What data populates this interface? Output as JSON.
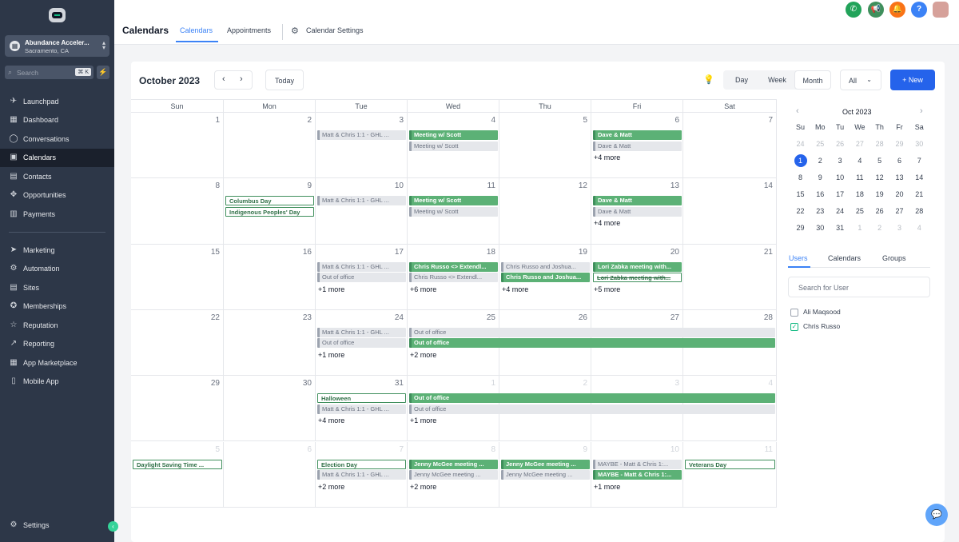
{
  "sidebar": {
    "account": {
      "name": "Abundance Acceler...",
      "location": "Sacramento, CA"
    },
    "search": {
      "placeholder": "Search",
      "shortcut": "⌘ K"
    },
    "items": [
      {
        "label": "Launchpad",
        "icon": "rocket-icon"
      },
      {
        "label": "Dashboard",
        "icon": "dashboard-icon"
      },
      {
        "label": "Conversations",
        "icon": "chat-icon"
      },
      {
        "label": "Calendars",
        "icon": "calendar-icon",
        "active": true
      },
      {
        "label": "Contacts",
        "icon": "contacts-icon"
      },
      {
        "label": "Opportunities",
        "icon": "opportunities-icon"
      },
      {
        "label": "Payments",
        "icon": "payments-icon"
      },
      {
        "label": "Marketing",
        "icon": "send-icon"
      },
      {
        "label": "Automation",
        "icon": "automation-icon"
      },
      {
        "label": "Sites",
        "icon": "sites-icon"
      },
      {
        "label": "Memberships",
        "icon": "memberships-icon"
      },
      {
        "label": "Reputation",
        "icon": "star-icon"
      },
      {
        "label": "Reporting",
        "icon": "reporting-icon"
      },
      {
        "label": "App Marketplace",
        "icon": "grid-icon"
      },
      {
        "label": "Mobile App",
        "icon": "mobile-icon"
      }
    ],
    "settings_label": "Settings"
  },
  "header": {
    "title": "Calendars",
    "tabs": [
      "Calendars",
      "Appointments"
    ],
    "settings_label": "Calendar Settings"
  },
  "toolbar": {
    "month_label": "October 2023",
    "today_label": "Today",
    "views": [
      "Day",
      "Week",
      "Month"
    ],
    "active_view": "Month",
    "filter_value": "All",
    "new_label": "+ New"
  },
  "calendar": {
    "weekdays": [
      "Sun",
      "Mon",
      "Tue",
      "Wed",
      "Thu",
      "Fri",
      "Sat"
    ],
    "weeks": [
      [
        {
          "d": "1"
        },
        {
          "d": "2"
        },
        {
          "d": "3"
        },
        {
          "d": "4"
        },
        {
          "d": "5"
        },
        {
          "d": "6"
        },
        {
          "d": "7"
        }
      ],
      [
        {
          "d": "8"
        },
        {
          "d": "9"
        },
        {
          "d": "10"
        },
        {
          "d": "11"
        },
        {
          "d": "12"
        },
        {
          "d": "13"
        },
        {
          "d": "14"
        }
      ],
      [
        {
          "d": "15"
        },
        {
          "d": "16"
        },
        {
          "d": "17"
        },
        {
          "d": "18"
        },
        {
          "d": "19"
        },
        {
          "d": "20"
        },
        {
          "d": "21"
        }
      ],
      [
        {
          "d": "22"
        },
        {
          "d": "23"
        },
        {
          "d": "24"
        },
        {
          "d": "25"
        },
        {
          "d": "26"
        },
        {
          "d": "27"
        },
        {
          "d": "28"
        }
      ],
      [
        {
          "d": "29"
        },
        {
          "d": "30"
        },
        {
          "d": "31"
        },
        {
          "d": "1",
          "other": true
        },
        {
          "d": "2",
          "other": true
        },
        {
          "d": "3",
          "other": true
        },
        {
          "d": "4",
          "other": true
        }
      ],
      [
        {
          "d": "5",
          "other": true
        },
        {
          "d": "6",
          "other": true
        },
        {
          "d": "7",
          "other": true
        },
        {
          "d": "8",
          "other": true
        },
        {
          "d": "9",
          "other": true
        },
        {
          "d": "10",
          "other": true
        },
        {
          "d": "11",
          "other": true
        }
      ]
    ],
    "events": [
      {
        "w": 0,
        "c": 2,
        "slot": 0,
        "span": 1,
        "text": "Matt & Chris 1:1 - GHL ...",
        "style": "gr"
      },
      {
        "w": 0,
        "c": 3,
        "slot": 0,
        "span": 1,
        "text": "Meeting w/ Scott",
        "style": "g"
      },
      {
        "w": 0,
        "c": 3,
        "slot": 1,
        "span": 1,
        "text": "Meeting w/ Scott",
        "style": "gr"
      },
      {
        "w": 0,
        "c": 5,
        "slot": 0,
        "span": 1,
        "text": "Dave & Matt",
        "style": "g"
      },
      {
        "w": 0,
        "c": 5,
        "slot": 1,
        "span": 1,
        "text": "Dave & Matt",
        "style": "gr"
      },
      {
        "w": 1,
        "c": 1,
        "slot": 0,
        "span": 1,
        "text": "Columbus Day",
        "style": "o"
      },
      {
        "w": 1,
        "c": 1,
        "slot": 1,
        "span": 1,
        "text": "Indigenous Peoples' Day",
        "style": "o"
      },
      {
        "w": 1,
        "c": 2,
        "slot": 0,
        "span": 1,
        "text": "Matt & Chris 1:1 - GHL ...",
        "style": "gr"
      },
      {
        "w": 1,
        "c": 3,
        "slot": 0,
        "span": 1,
        "text": "Meeting w/ Scott",
        "style": "g"
      },
      {
        "w": 1,
        "c": 3,
        "slot": 1,
        "span": 1,
        "text": "Meeting w/ Scott",
        "style": "gr"
      },
      {
        "w": 1,
        "c": 5,
        "slot": 0,
        "span": 1,
        "text": "Dave & Matt",
        "style": "g"
      },
      {
        "w": 1,
        "c": 5,
        "slot": 1,
        "span": 1,
        "text": "Dave & Matt",
        "style": "gr"
      },
      {
        "w": 2,
        "c": 2,
        "slot": 0,
        "span": 1,
        "text": "Matt & Chris 1:1 - GHL ...",
        "style": "gr"
      },
      {
        "w": 2,
        "c": 2,
        "slot": 1,
        "span": 1,
        "text": "Out of office",
        "style": "gr"
      },
      {
        "w": 2,
        "c": 3,
        "slot": 0,
        "span": 1,
        "text": "Chris Russo <> Extendl...",
        "style": "g"
      },
      {
        "w": 2,
        "c": 3,
        "slot": 1,
        "span": 1,
        "text": "Chris Russo <> Extendl...",
        "style": "gr"
      },
      {
        "w": 2,
        "c": 4,
        "slot": 0,
        "span": 1,
        "text": "Chris Russo and Joshua...",
        "style": "gr"
      },
      {
        "w": 2,
        "c": 4,
        "slot": 1,
        "span": 1,
        "text": "Chris Russo and Joshua...",
        "style": "g"
      },
      {
        "w": 2,
        "c": 5,
        "slot": 0,
        "span": 1,
        "text": "Lori Zabka meeting with...",
        "style": "g"
      },
      {
        "w": 2,
        "c": 5,
        "slot": 1,
        "span": 1,
        "text": "Lori Zabka meeting with...",
        "style": "o st"
      },
      {
        "w": 3,
        "c": 2,
        "slot": 0,
        "span": 1,
        "text": "Matt & Chris 1:1 - GHL ...",
        "style": "gr"
      },
      {
        "w": 3,
        "c": 2,
        "slot": 1,
        "span": 1,
        "text": "Out of office",
        "style": "gr"
      },
      {
        "w": 3,
        "c": 3,
        "slot": 0,
        "span": 4,
        "text": "Out of office",
        "style": "gr"
      },
      {
        "w": 3,
        "c": 3,
        "slot": 1,
        "span": 4,
        "text": "Out of office",
        "style": "g"
      },
      {
        "w": 4,
        "c": 2,
        "slot": 0,
        "span": 1,
        "text": "Halloween",
        "style": "o"
      },
      {
        "w": 4,
        "c": 2,
        "slot": 1,
        "span": 1,
        "text": "Matt & Chris 1:1 - GHL ...",
        "style": "gr"
      },
      {
        "w": 4,
        "c": 3,
        "slot": 0,
        "span": 4,
        "text": "Out of office",
        "style": "g"
      },
      {
        "w": 4,
        "c": 3,
        "slot": 1,
        "span": 4,
        "text": "Out of office",
        "style": "gr"
      },
      {
        "w": 5,
        "c": 0,
        "slot": 0,
        "span": 1,
        "text": "Daylight Saving Time ...",
        "style": "o"
      },
      {
        "w": 5,
        "c": 2,
        "slot": 0,
        "span": 1,
        "text": "Election Day",
        "style": "o"
      },
      {
        "w": 5,
        "c": 2,
        "slot": 1,
        "span": 1,
        "text": "Matt & Chris 1:1 - GHL ...",
        "style": "gr"
      },
      {
        "w": 5,
        "c": 3,
        "slot": 0,
        "span": 1,
        "text": "Jenny McGee meeting ...",
        "style": "g"
      },
      {
        "w": 5,
        "c": 3,
        "slot": 1,
        "span": 1,
        "text": "Jenny McGee meeting ...",
        "style": "gr"
      },
      {
        "w": 5,
        "c": 4,
        "slot": 0,
        "span": 1,
        "text": "Jenny McGee meeting ...",
        "style": "g"
      },
      {
        "w": 5,
        "c": 4,
        "slot": 1,
        "span": 1,
        "text": "Jenny McGee meeting ...",
        "style": "gr"
      },
      {
        "w": 5,
        "c": 5,
        "slot": 0,
        "span": 1,
        "text": "MAYBE - Matt & Chris 1:...",
        "style": "gr"
      },
      {
        "w": 5,
        "c": 5,
        "slot": 1,
        "span": 1,
        "text": "MAYBE - Matt & Chris 1:...",
        "style": "g"
      },
      {
        "w": 5,
        "c": 6,
        "slot": 0,
        "span": 1,
        "text": "Veterans Day",
        "style": "o"
      }
    ],
    "more": [
      {
        "w": 0,
        "c": 5,
        "text": "+4 more"
      },
      {
        "w": 1,
        "c": 5,
        "text": "+4 more"
      },
      {
        "w": 2,
        "c": 2,
        "text": "+1 more"
      },
      {
        "w": 2,
        "c": 3,
        "text": "+6 more"
      },
      {
        "w": 2,
        "c": 4,
        "text": "+4 more"
      },
      {
        "w": 2,
        "c": 5,
        "text": "+5 more"
      },
      {
        "w": 3,
        "c": 2,
        "text": "+1 more"
      },
      {
        "w": 3,
        "c": 3,
        "text": "+2 more"
      },
      {
        "w": 4,
        "c": 2,
        "text": "+4 more"
      },
      {
        "w": 4,
        "c": 3,
        "text": "+1 more"
      },
      {
        "w": 5,
        "c": 2,
        "text": "+2 more"
      },
      {
        "w": 5,
        "c": 3,
        "text": "+2 more"
      },
      {
        "w": 5,
        "c": 5,
        "text": "+1 more"
      }
    ]
  },
  "mini_calendar": {
    "title": "Oct 2023",
    "weekdays": [
      "Su",
      "Mo",
      "Tu",
      "We",
      "Th",
      "Fr",
      "Sa"
    ],
    "days": [
      [
        "24",
        "25",
        "26",
        "27",
        "28",
        "29",
        "30"
      ],
      [
        "1",
        "2",
        "3",
        "4",
        "5",
        "6",
        "7"
      ],
      [
        "8",
        "9",
        "10",
        "11",
        "12",
        "13",
        "14"
      ],
      [
        "15",
        "16",
        "17",
        "18",
        "19",
        "20",
        "21"
      ],
      [
        "22",
        "23",
        "24",
        "25",
        "26",
        "27",
        "28"
      ],
      [
        "29",
        "30",
        "31",
        "1",
        "2",
        "3",
        "4"
      ]
    ],
    "selected": "1"
  },
  "side_panel": {
    "tabs": [
      "Users",
      "Calendars",
      "Groups"
    ],
    "search_placeholder": "Search for User",
    "users": [
      {
        "name": "Ali Maqsood",
        "checked": false
      },
      {
        "name": "Chris Russo",
        "checked": true
      }
    ]
  },
  "colors": {
    "accent": "#2563eb",
    "event_green": "#5cb176",
    "sidebar_bg": "#2d3748"
  }
}
